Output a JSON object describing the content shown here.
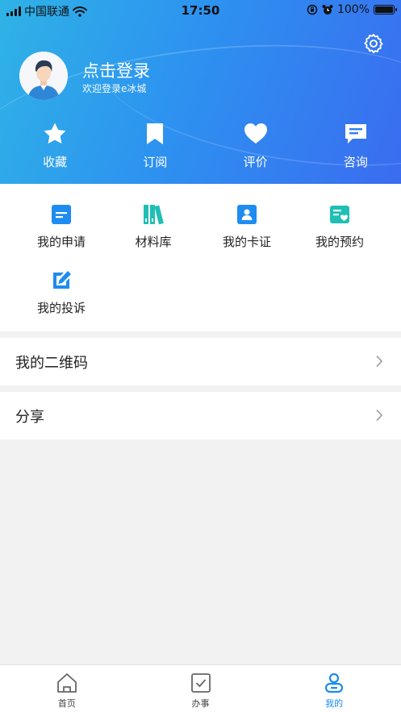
{
  "status_bar": {
    "carrier": "中国联通",
    "time": "17:50",
    "battery": "100%"
  },
  "header": {
    "login_title": "点击登录",
    "login_subtitle": "欢迎登录e冰城",
    "quick_actions": [
      {
        "label": "收藏",
        "icon": "star-icon"
      },
      {
        "label": "订阅",
        "icon": "bookmark-icon"
      },
      {
        "label": "评价",
        "icon": "heart-icon"
      },
      {
        "label": "咨询",
        "icon": "chat-icon"
      }
    ]
  },
  "services": [
    {
      "label": "我的申请",
      "icon": "application-doc-icon",
      "color": "#1e8cf0"
    },
    {
      "label": "材料库",
      "icon": "books-icon",
      "color": "#1fbfb4"
    },
    {
      "label": "我的卡证",
      "icon": "id-card-icon",
      "color": "#1e8cf0"
    },
    {
      "label": "我的预约",
      "icon": "appointment-icon",
      "color": "#1fbfb4"
    },
    {
      "label": "我的投诉",
      "icon": "edit-icon",
      "color": "#1e8cf0"
    }
  ],
  "menu": {
    "qrcode": "我的二维码",
    "share": "分享"
  },
  "tabbar": {
    "tabs": [
      {
        "label": "首页",
        "icon": "home-icon"
      },
      {
        "label": "办事",
        "icon": "checkbox-icon"
      },
      {
        "label": "我的",
        "icon": "user-icon"
      }
    ],
    "active": "我的",
    "active_color": "#1a8cf0"
  }
}
